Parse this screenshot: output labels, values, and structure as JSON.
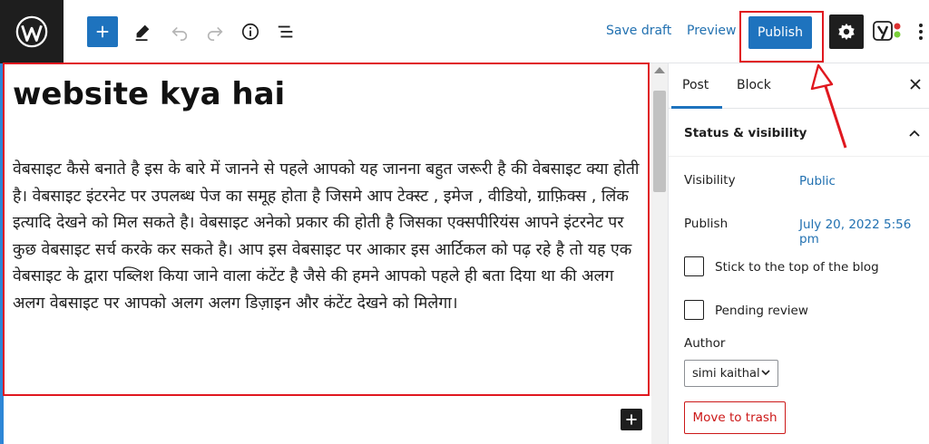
{
  "toolbar": {
    "save_draft": "Save draft",
    "preview": "Preview",
    "publish": "Publish",
    "icons": [
      "wordpress-logo",
      "plus-icon",
      "pencil-icon",
      "undo-icon",
      "redo-icon",
      "info-icon",
      "list-view-icon",
      "gear-icon",
      "yoast-icon",
      "more-vertical-icon"
    ]
  },
  "post": {
    "title": "website kya hai",
    "body": "वेबसाइट कैसे बनाते है इस के बारे में जानने से पहले आपको यह जानना बहुत जरूरी है की वेबसाइट क्या होती है। वेबसाइट इंटरनेट पर उपलब्ध पेज का समूह होता है जिसमे आप टेक्स्ट , इमेज , वीडियो, ग्राफ़िक्स , लिंक इत्यादि देखने को मिल सकते है। वेबसाइट अनेको प्रकार की होती है जिसका एक्सपीरियंस आपने इंटरनेट पर कुछ वेबसाइट सर्च करके कर सकते है। आप इस वेबसाइट पर आकार इस आर्टिकल को पढ़ रहे है तो यह एक वेबसाइट के द्वारा पब्लिश किया जाने वाला कंटेंट है जैसे की हमने आपको पहले ही बता दिया था की अलग अलग वेबसाइट पर आपको अलग अलग डिज़ाइन और कंटेंट देखने को मिलेगा।"
  },
  "sidebar": {
    "tabs": [
      "Post",
      "Block"
    ],
    "active_tab": "Post",
    "section_title": "Status & visibility",
    "visibility_label": "Visibility",
    "visibility_value": "Public",
    "publish_label": "Publish",
    "publish_value": "July 20, 2022 5:56 pm",
    "sticky_label": "Stick to the top of the blog",
    "pending_label": "Pending review",
    "author_label": "Author",
    "author_value": "simi kaithal",
    "trash_label": "Move to trash"
  },
  "colors": {
    "accent": "#1e73be",
    "annotation": "#e0181f",
    "link": "#2271b1",
    "danger": "#cc1818"
  }
}
